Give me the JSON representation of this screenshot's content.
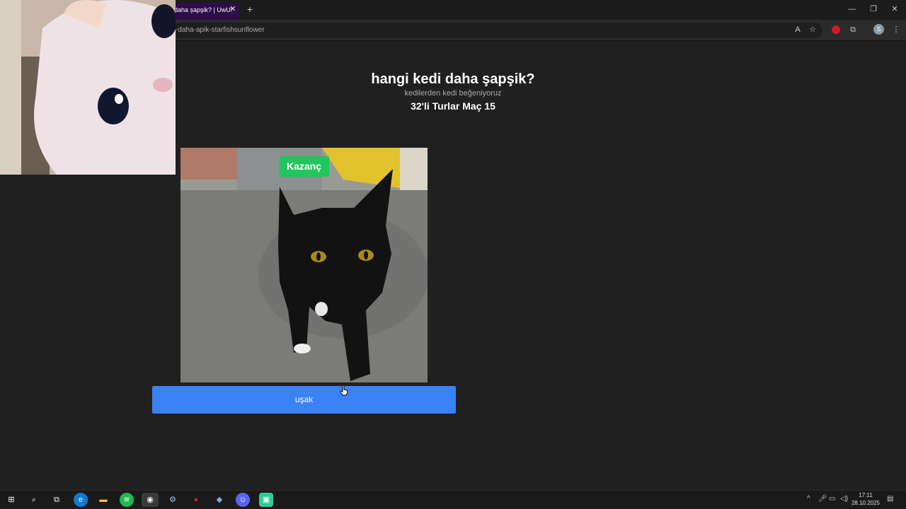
{
  "browser": {
    "tab_title": "daha şapşik? | UwU!",
    "url": "-daha-apik-starfishsunflower",
    "new_tab_label": "+",
    "avatar_initial": "S"
  },
  "page": {
    "title": "hangi kedi daha şapşik?",
    "subtitle": "kedilerden kedi beğeniyoruz",
    "round": "32'li Turlar Maç 15"
  },
  "candidate": {
    "badge": "Kazanç",
    "button_label": "uşak"
  },
  "taskbar": {
    "time": "17:11",
    "date": "28.10.2025"
  },
  "colors": {
    "accent_button": "#3b82f6",
    "badge_green": "#22c55e",
    "tab_purple": "#2f0c4a"
  }
}
